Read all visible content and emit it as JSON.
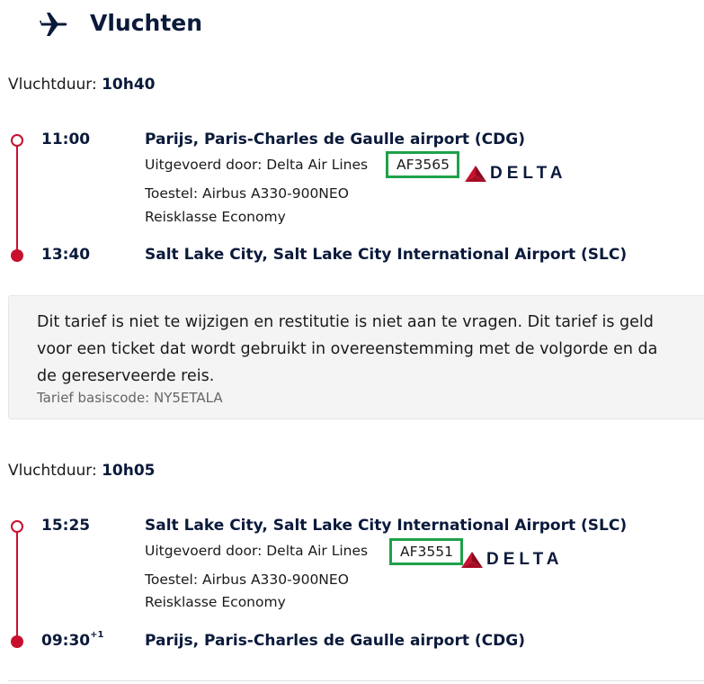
{
  "header": {
    "title": "Vluchten",
    "icon": "plane-icon"
  },
  "segments": [
    {
      "duration_label": "Vluchtduur:",
      "duration_value": "10h40",
      "departure": {
        "time": "11:00",
        "airport": "Parijs, Paris-Charles de Gaulle airport (CDG)"
      },
      "operated_by": "Uitgevoerd door: Delta Air Lines",
      "flight_code": "AF3565",
      "airline_logo_text": "DELTA",
      "aircraft": "Toestel: Airbus A330-900NEO",
      "cabin": "Reisklasse Economy",
      "arrival": {
        "time": "13:40",
        "day_offset": "",
        "airport": "Salt Lake City, Salt Lake City International Airport (SLC)"
      }
    },
    {
      "duration_label": "Vluchtduur:",
      "duration_value": "10h05",
      "departure": {
        "time": "15:25",
        "airport": "Salt Lake City, Salt Lake City International Airport (SLC)"
      },
      "operated_by": "Uitgevoerd door: Delta Air Lines",
      "flight_code": "AF3551",
      "airline_logo_text": "DELTA",
      "aircraft": "Toestel: Airbus A330-900NEO",
      "cabin": "Reisklasse Economy",
      "arrival": {
        "time": "09:30",
        "day_offset": "+1",
        "airport": "Parijs, Paris-Charles de Gaulle airport (CDG)"
      }
    }
  ],
  "fare": {
    "lines": [
      "Dit tarief is niet te wijzigen en restitutie is niet aan te vragen. Dit tarief is geld",
      "voor een ticket dat wordt gebruikt in overeenstemming met de volgorde en da",
      "de gereserveerde reis."
    ],
    "basis_code": "Tarief basiscode: NY5ETALA"
  },
  "colors": {
    "timeline": "#c8102e",
    "highlight_box": "#1fa14a",
    "heading": "#0b1a3b",
    "delta_red": "#c8102e"
  }
}
